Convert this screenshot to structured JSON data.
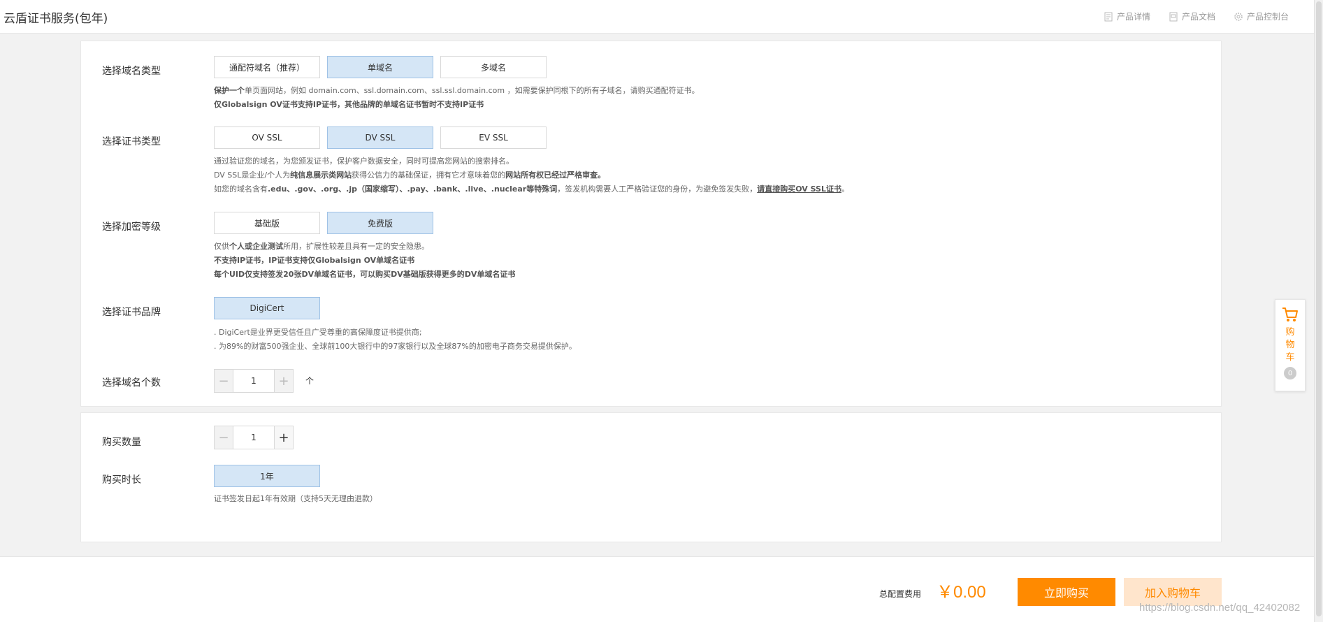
{
  "header": {
    "title": "云盾证书服务(包年)",
    "links": [
      {
        "label": "产品详情",
        "icon": "document-icon"
      },
      {
        "label": "产品文档",
        "icon": "file-icon"
      },
      {
        "label": "产品控制台",
        "icon": "gear-icon"
      }
    ]
  },
  "domain_type": {
    "label": "选择域名类型",
    "options": [
      "通配符域名（推荐）",
      "单域名",
      "多域名"
    ],
    "selected": "单域名",
    "note_line1_bold": "保护一个",
    "note_line1_rest": "单页面网站，例如 domain.com、ssl.domain.com、ssl.ssl.domain.com ，如需要保护同根下的所有子域名，请购买通配符证书。",
    "note_line2": "仅Globalsign OV证书支持IP证书，其他品牌的单域名证书暂时不支持IP证书"
  },
  "cert_type": {
    "label": "选择证书类型",
    "options": [
      "OV SSL",
      "DV SSL",
      "EV SSL"
    ],
    "selected": "DV SSL",
    "note_line1": "通过验证您的域名，为您颁发证书，保护客户数据安全，同时可提高您网站的搜索排名。",
    "note_line2_a": "DV SSL是企业/个人为",
    "note_line2_b": "纯信息展示类网站",
    "note_line2_c": "获得公信力的基础保证，拥有它才意味着您的",
    "note_line2_d": "网站所有权已经过严格审查。",
    "note_line3_a": "如您的域名含有",
    "note_line3_b": ".edu、.gov、.org、.jp（国家缩写）、.pay、.bank、.live、.nuclear等特殊词",
    "note_line3_c": "，签发机构需要人工严格验证您的身份，为避免签发失败，",
    "note_line3_d": "请直接购买OV SSL证书",
    "note_line3_e": "。"
  },
  "encryption": {
    "label": "选择加密等级",
    "options": [
      "基础版",
      "免费版"
    ],
    "selected": "免费版",
    "note_line1_a": "仅供",
    "note_line1_b": "个人或企业测试",
    "note_line1_c": "所用，扩展性较差且具有一定的安全隐患。",
    "note_line2": "不支持IP证书，IP证书支持仅Globalsign OV单域名证书",
    "note_line3": "每个UID仅支持签发20张DV单域名证书，可以购买DV基础版获得更多的DV单域名证书"
  },
  "brand": {
    "label": "选择证书品牌",
    "options": [
      "DigiCert"
    ],
    "selected": "DigiCert",
    "note_line1": ". DigiCert是业界更受信任且广受尊重的高保障度证书提供商;",
    "note_line2": ". 为89%的财富500强企业、全球前100大银行中的97家银行以及全球87%的加密电子商务交易提供保护。"
  },
  "domain_count": {
    "label": "选择域名个数",
    "minus": "−",
    "value": "1",
    "plus": "+",
    "unit": "个"
  },
  "quantity": {
    "label": "购买数量",
    "minus": "−",
    "value": "1",
    "plus": "+"
  },
  "duration": {
    "label": "购买时长",
    "options": [
      "1年"
    ],
    "selected": "1年",
    "note": "证书签发日起1年有效期（支持5天无理由退款）"
  },
  "footer": {
    "fee_label": "总配置费用",
    "price": "￥0.00",
    "buy_label": "立即购买",
    "cart_label": "加入购物车",
    "watermark": "https://blog.csdn.net/qq_42402082"
  },
  "float_cart": {
    "label": "购物车",
    "count": "0",
    "icon": "cart-icon"
  },
  "colors": {
    "accent": "#ff8a00",
    "selected_bg": "#d5e6f6"
  }
}
